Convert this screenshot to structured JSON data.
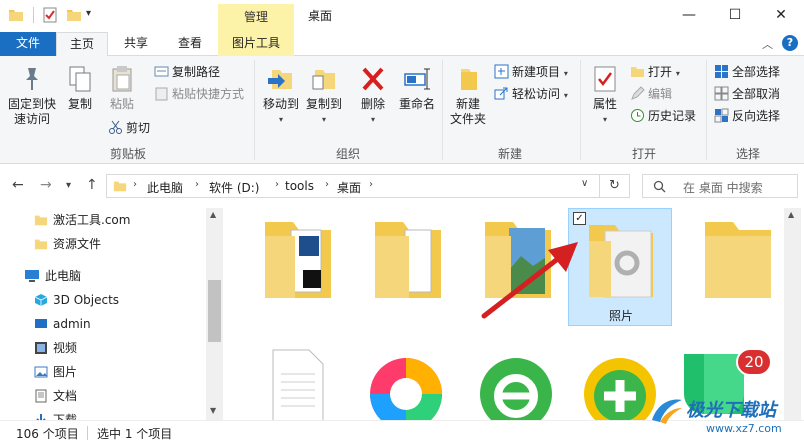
{
  "window": {
    "title": "桌面",
    "manage_label": "管理",
    "minimize": "—",
    "maximize": "☐",
    "close": "✕"
  },
  "tabs": {
    "file": "文件",
    "home": "主页",
    "share": "共享",
    "view": "查看",
    "picture_tools": "图片工具"
  },
  "ribbon": {
    "clipboard": {
      "pin": "固定到快",
      "pin2": "速访问",
      "copy": "复制",
      "paste": "粘贴",
      "copy_path": "复制路径",
      "paste_shortcut": "粘贴快捷方式",
      "cut": "剪切",
      "label": "剪贴板"
    },
    "organize": {
      "move_to": "移动到",
      "copy_to": "复制到",
      "delete": "删除",
      "rename": "重命名",
      "label": "组织"
    },
    "new": {
      "new_folder": "新建",
      "new_folder2": "文件夹",
      "new_item": "新建项目",
      "easy_access": "轻松访问",
      "label": "新建"
    },
    "open": {
      "properties": "属性",
      "open": "打开",
      "edit": "编辑",
      "history": "历史记录",
      "label": "打开"
    },
    "select": {
      "select_all": "全部选择",
      "select_none": "全部取消",
      "invert": "反向选择",
      "label": "选择"
    }
  },
  "address": {
    "crumbs": [
      "此电脑",
      "软件 (D:)",
      "tools",
      "桌面"
    ],
    "search_placeholder": "在 桌面 中搜索"
  },
  "nav": {
    "items": [
      "激活工具.com",
      "资源文件",
      "此电脑",
      "3D Objects",
      "admin",
      "视频",
      "图片",
      "文档",
      "下载"
    ]
  },
  "content": {
    "selected_label": "照片",
    "badge": "20"
  },
  "status": {
    "count": "106 个项目",
    "selected": "选中 1 个项目"
  },
  "watermark": {
    "brand": "极光下载站",
    "url": "www.xz7.com"
  },
  "colors": {
    "accent": "#1a6fc3",
    "manage_tab": "#fdf3a8",
    "selection": "#cce8ff",
    "folder": "#f5d67b",
    "arrow": "#d42020"
  }
}
